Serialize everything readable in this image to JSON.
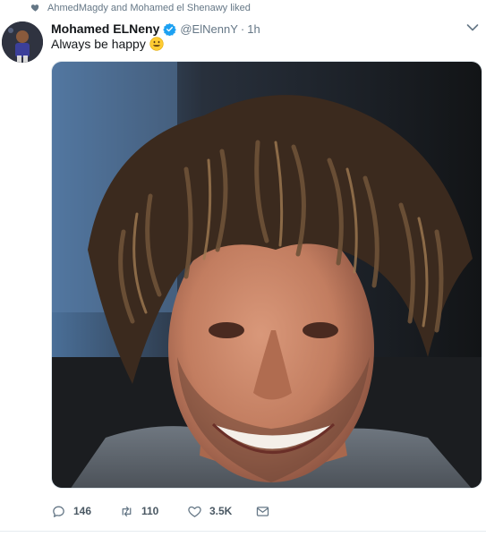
{
  "social_context": {
    "icon": "heart-icon",
    "text": "AhmedMagdy and Mohamed el Shenawy liked"
  },
  "tweet": {
    "author": {
      "name": "Mohamed ELNeny",
      "handle": "@ElNennY",
      "verified": true
    },
    "time_separator": "·",
    "time": "1h",
    "text": "Always be happy",
    "emoji": "smiling-face",
    "media": {
      "description_icon": "photo"
    },
    "actions": {
      "reply_count": "146",
      "retweet_count": "110",
      "like_count": "3.5K"
    }
  },
  "colors": {
    "text_primary": "#14171a",
    "text_secondary": "#657786",
    "verified_blue": "#1da1f2",
    "divider": "#e6ecf0"
  }
}
